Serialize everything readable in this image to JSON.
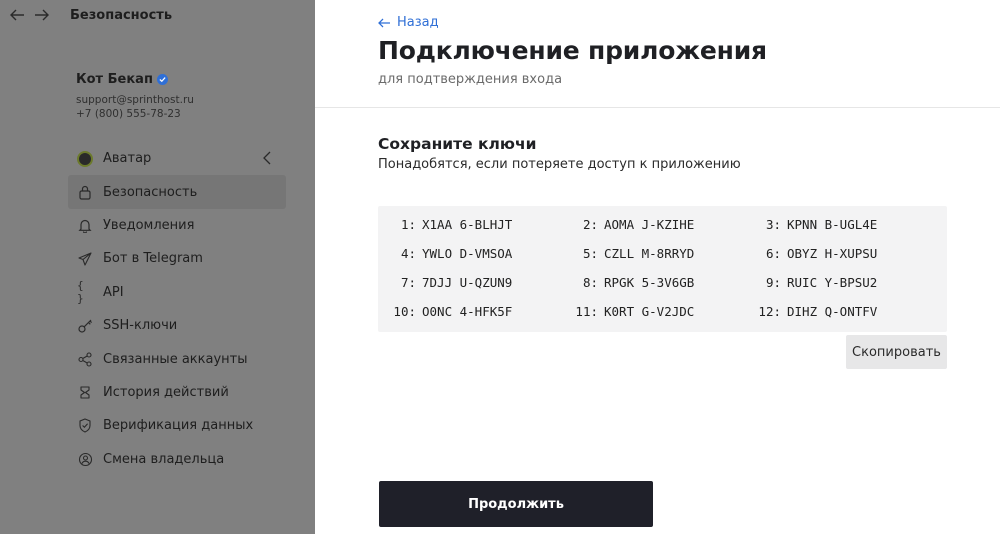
{
  "sidebar": {
    "header_title": "Безопасность",
    "profile": {
      "name": "Кот Бекап",
      "email": "support@sprinthost.ru",
      "phone": "+7 (800) 555-78-23"
    },
    "items": [
      {
        "label": "Аватар",
        "icon": "avatar-icon"
      },
      {
        "label": "Безопасность",
        "icon": "lock-icon",
        "active": true
      },
      {
        "label": "Уведомления",
        "icon": "bell-icon"
      },
      {
        "label": "Бот в Telegram",
        "icon": "telegram-icon"
      },
      {
        "label": "API",
        "icon": "braces-icon"
      },
      {
        "label": "SSH-ключи",
        "icon": "key-icon"
      },
      {
        "label": "Связанные аккаунты",
        "icon": "share-icon"
      },
      {
        "label": "История действий",
        "icon": "history-icon"
      },
      {
        "label": "Верификация данных",
        "icon": "shield-check-icon"
      },
      {
        "label": "Смена владельца",
        "icon": "owner-change-icon"
      }
    ]
  },
  "main": {
    "back_label": "Назад",
    "title": "Подключение приложения",
    "subtitle": "для подтверждения входа",
    "section_title": "Сохраните ключи",
    "section_desc": "Понадобятся, если потеряете доступ к приложению",
    "keys": [
      {
        "num": "1:",
        "code": "X1AA 6-BLHJT"
      },
      {
        "num": "2:",
        "code": "AOMA J-KZIHE"
      },
      {
        "num": "3:",
        "code": "KPNN B-UGL4E"
      },
      {
        "num": "4:",
        "code": "YWLO D-VMSOA"
      },
      {
        "num": "5:",
        "code": "CZLL M-8RRYD"
      },
      {
        "num": "6:",
        "code": "OBYZ H-XUPSU"
      },
      {
        "num": "7:",
        "code": "7DJJ U-QZUN9"
      },
      {
        "num": "8:",
        "code": "RPGK 5-3V6GB"
      },
      {
        "num": "9:",
        "code": "RUIC Y-BPSU2"
      },
      {
        "num": "10:",
        "code": "O0NC 4-HFK5F"
      },
      {
        "num": "11:",
        "code": "K0RT G-V2JDC"
      },
      {
        "num": "12:",
        "code": "DIHZ Q-ONTFV"
      }
    ],
    "copy_label": "Скопировать",
    "continue_label": "Продолжить"
  },
  "colors": {
    "accent": "#2f6fd6",
    "overlay": "#808080",
    "primary_button": "#1f2029",
    "keys_background": "#f3f3f4"
  }
}
